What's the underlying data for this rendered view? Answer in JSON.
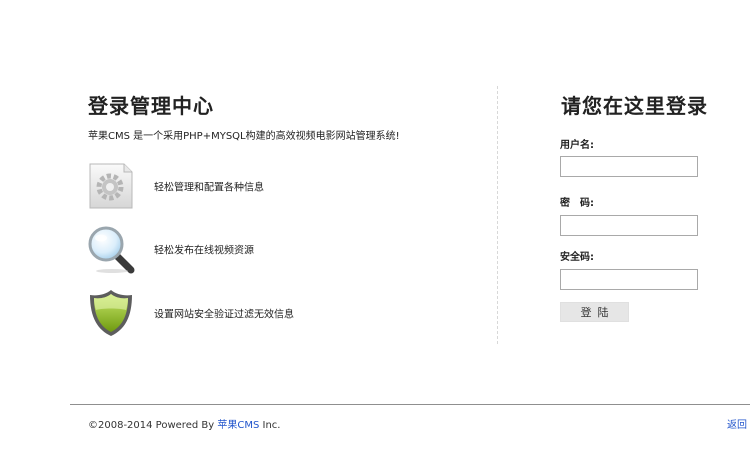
{
  "intro": {
    "title": "登录管理中心",
    "description": "苹果CMS 是一个采用PHP+MYSQL构建的高效视频电影网站管理系统!",
    "features": [
      {
        "icon": "gear-document-icon",
        "label": "轻松管理和配置各种信息"
      },
      {
        "icon": "magnifier-icon",
        "label": "轻松发布在线视频资源"
      },
      {
        "icon": "shield-icon",
        "label": "设置网站安全验证过滤无效信息"
      }
    ]
  },
  "login": {
    "title": "请您在这里登录",
    "username_label": "用户名:",
    "username_value": "",
    "password_label": "密　码:",
    "password_value": "",
    "security_code_label": "安全码:",
    "security_code_value": "",
    "submit_label": "登陆"
  },
  "footer": {
    "copyright_prefix": "©2008-2014 Powered By ",
    "brand_link": "苹果CMS",
    "copyright_suffix": " Inc.",
    "back_link": "返回"
  },
  "colors": {
    "link": "#2255cc",
    "shield_green": "#8fbf1a",
    "divider": "#8f8f8f"
  }
}
